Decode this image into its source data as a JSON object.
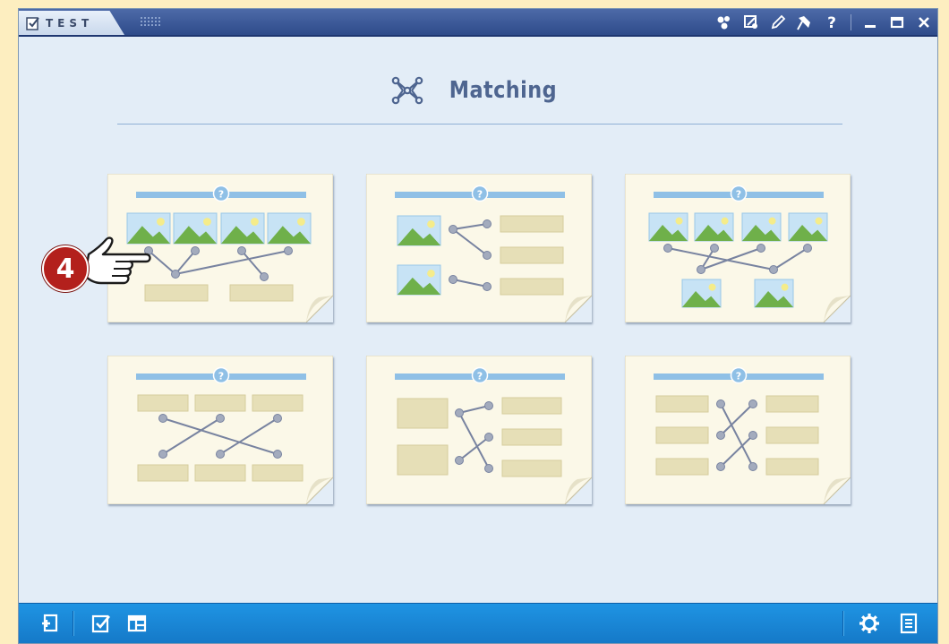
{
  "window": {
    "app_title": "TEST",
    "title_icons": [
      "shapes-icon",
      "tools-icon",
      "pencil-icon",
      "pin-icon",
      "help-icon",
      "minimize-icon",
      "maximize-icon",
      "close-icon"
    ]
  },
  "page": {
    "title": "Matching",
    "title_icon": "matching-network-icon"
  },
  "layouts": [
    {
      "name": "images-top-to-texts-bottom"
    },
    {
      "name": "images-left-to-texts-right"
    },
    {
      "name": "images-top-to-images-bottom"
    },
    {
      "name": "texts-top-to-texts-bottom"
    },
    {
      "name": "text-blocks-left-to-texts-right"
    },
    {
      "name": "texts-left-to-texts-right"
    }
  ],
  "callout": {
    "number": "4"
  },
  "bottom_bar": {
    "left_icons": [
      "insert-slide-icon",
      "checklist-icon",
      "layout-grid-icon"
    ],
    "right_icons": [
      "settings-icon",
      "document-icon"
    ]
  },
  "colors": {
    "titlebar": "#34518f",
    "window_bg": "#e3edf7",
    "bottom_bar": "#1b88d8",
    "card_bg": "#fbf8e8",
    "bar": "#8fc0e6",
    "node": "#a3abbd",
    "line": "#7883a0",
    "text_box": "#e6dfb7",
    "badge": "#b3201c"
  }
}
